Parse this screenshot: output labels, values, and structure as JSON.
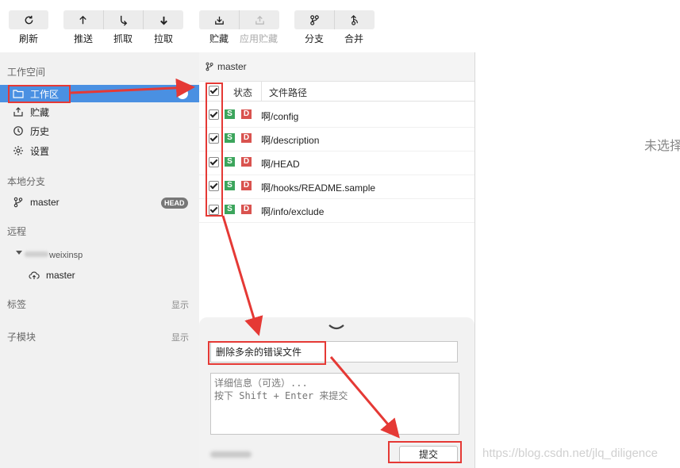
{
  "toolbar": {
    "buttons": [
      {
        "label": "刷新",
        "icon": "refresh-icon",
        "disabled": false
      },
      {
        "label": "推送",
        "icon": "push-icon",
        "disabled": false
      },
      {
        "label": "抓取",
        "icon": "fetch-icon",
        "disabled": false
      },
      {
        "label": "拉取",
        "icon": "pull-icon",
        "disabled": false
      },
      {
        "label": "贮藏",
        "icon": "stash-icon",
        "disabled": false
      },
      {
        "label": "应用贮藏",
        "icon": "apply-stash-icon",
        "disabled": true
      },
      {
        "label": "分支",
        "icon": "branch-icon",
        "disabled": false
      },
      {
        "label": "合并",
        "icon": "merge-icon",
        "disabled": false
      }
    ]
  },
  "sidebar": {
    "workspace": {
      "heading": "工作空间",
      "items": [
        {
          "label": "工作区",
          "icon": "folder-icon",
          "active": true
        },
        {
          "label": "贮藏",
          "icon": "stash-icon"
        },
        {
          "label": "历史",
          "icon": "history-icon"
        },
        {
          "label": "设置",
          "icon": "gear-icon"
        }
      ]
    },
    "local_branches": {
      "heading": "本地分支",
      "items": [
        {
          "label": "master",
          "badge": "HEAD",
          "icon": "branch-icon"
        }
      ]
    },
    "remotes": {
      "heading": "远程",
      "remote_name": "weixinsp",
      "branches": [
        {
          "label": "master",
          "icon": "cloud-icon"
        }
      ]
    },
    "tags": {
      "heading": "标签",
      "action": "显示"
    },
    "submodules": {
      "heading": "子模块",
      "action": "显示"
    }
  },
  "changes": {
    "branch": "master",
    "columns": {
      "status": "状态",
      "path": "文件路径"
    },
    "files": [
      {
        "s": "S",
        "d": "D",
        "path": "啊/config"
      },
      {
        "s": "S",
        "d": "D",
        "path": "啊/description"
      },
      {
        "s": "S",
        "d": "D",
        "path": "啊/HEAD"
      },
      {
        "s": "S",
        "d": "D",
        "path": "啊/hooks/README.sample"
      },
      {
        "s": "S",
        "d": "D",
        "path": "啊/info/exclude"
      }
    ]
  },
  "commit": {
    "summary": "删除多余的错误文件",
    "description_placeholder": "详细信息（可选）...\n按下 Shift + Enter 来提交",
    "button": "提交"
  },
  "detail": {
    "empty_message": "未选择"
  },
  "watermark": "https://blog.csdn.net/jlq_diligence",
  "colors": {
    "accent": "#4a90e2",
    "annotation": "#e53935",
    "status_s": "#3ca55c",
    "status_d": "#d9534f"
  }
}
